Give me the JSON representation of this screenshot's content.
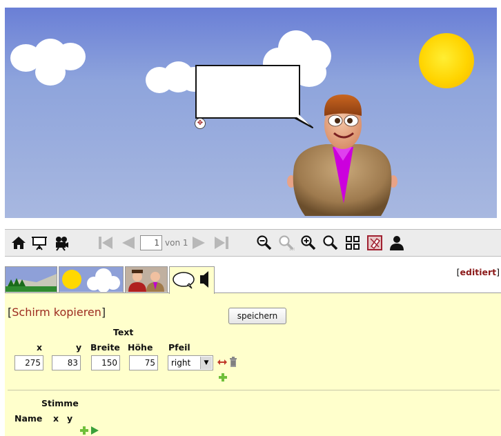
{
  "toolbar": {
    "page_number": "1",
    "page_of": "von 1",
    "icons": [
      "home-icon",
      "presentation-icon",
      "camera-icon",
      "first-page-icon",
      "previous-page-icon",
      "next-page-icon",
      "last-page-icon",
      "zoom-out-icon",
      "zoom-100-icon",
      "zoom-in-icon",
      "zoom-reset-icon",
      "grid-icon",
      "erase-icon",
      "person-icon"
    ]
  },
  "tabs": [
    "landscape-tab",
    "sky-tab",
    "characters-tab",
    "speech-tab"
  ],
  "status": {
    "edited": "editiert"
  },
  "panel": {
    "copy_link": "Schirm kopieren",
    "save_button": "speichern",
    "text_section": "Text",
    "headers": {
      "x": "x",
      "y": "y",
      "width": "Breite",
      "height": "Höhe",
      "arrow": "Pfeil"
    },
    "values": {
      "x": "275",
      "y": "83",
      "width": "150",
      "height": "75",
      "arrow": "right"
    },
    "voice_section": "Stimme",
    "voice_headers": {
      "name": "Name",
      "x": "x",
      "y": "y"
    }
  },
  "colors": {
    "panel_bg": "#ffffcc",
    "link": "#9c2a1f",
    "edited": "#8b1a1a",
    "sky": "#8ea4dc"
  }
}
